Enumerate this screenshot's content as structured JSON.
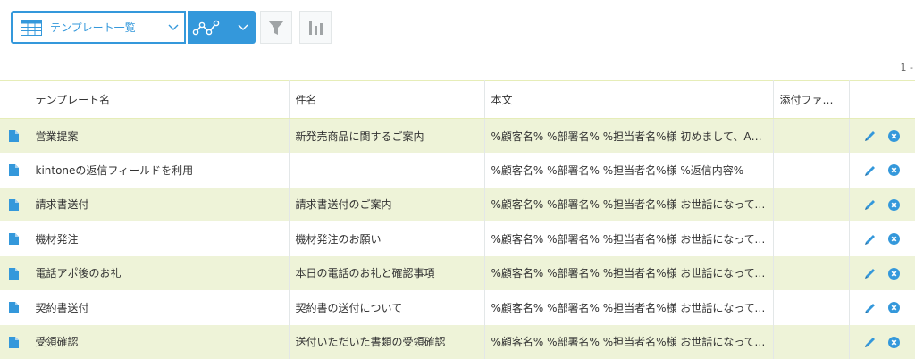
{
  "toolbar": {
    "view_label": "テンプレート一覧",
    "view_icon": "table-icon",
    "graph_icon": "graph-icon",
    "filter_icon": "filter-icon",
    "stats_icon": "bar-chart-icon"
  },
  "pager": {
    "text": "1 -"
  },
  "columns": [
    "テンプレート名",
    "件名",
    "本文",
    "添付ファイル"
  ],
  "rows": [
    {
      "name": "営業提案",
      "subject": "新発売商品に関するご案内",
      "body": "%顧客名% %部署名% %担当者名%様 初めまして、ABCD商事の",
      "attachment": ""
    },
    {
      "name": "kintoneの返信フィールドを利用",
      "subject": "",
      "body": "%顧客名% %部署名% %担当者名%様 %返信内容%",
      "attachment": ""
    },
    {
      "name": "請求書送付",
      "subject": "請求書送付のご案内",
      "body": "%顧客名% %部署名% %担当者名%様 お世話になっております",
      "attachment": ""
    },
    {
      "name": "機材発注",
      "subject": "機材発注のお願い",
      "body": "%顧客名% %部署名% %担当者名%様 お世話になっております",
      "attachment": ""
    },
    {
      "name": "電話アポ後のお礼",
      "subject": "本日の電話のお礼と確認事項",
      "body": "%顧客名% %部署名% %担当者名%様 お世話になっております",
      "attachment": ""
    },
    {
      "name": "契約書送付",
      "subject": "契約書の送付について",
      "body": "%顧客名% %部署名% %担当者名%様 お世話になっております",
      "attachment": ""
    },
    {
      "name": "受領確認",
      "subject": "送付いただいた書類の受領確認",
      "body": "%顧客名% %部署名% %担当者名%様 お世話になっております",
      "attachment": ""
    }
  ],
  "colors": {
    "accent": "#3498db",
    "row_stripe": "#eef3d8",
    "border": "#e3e7e8",
    "delete": "#3498db"
  }
}
